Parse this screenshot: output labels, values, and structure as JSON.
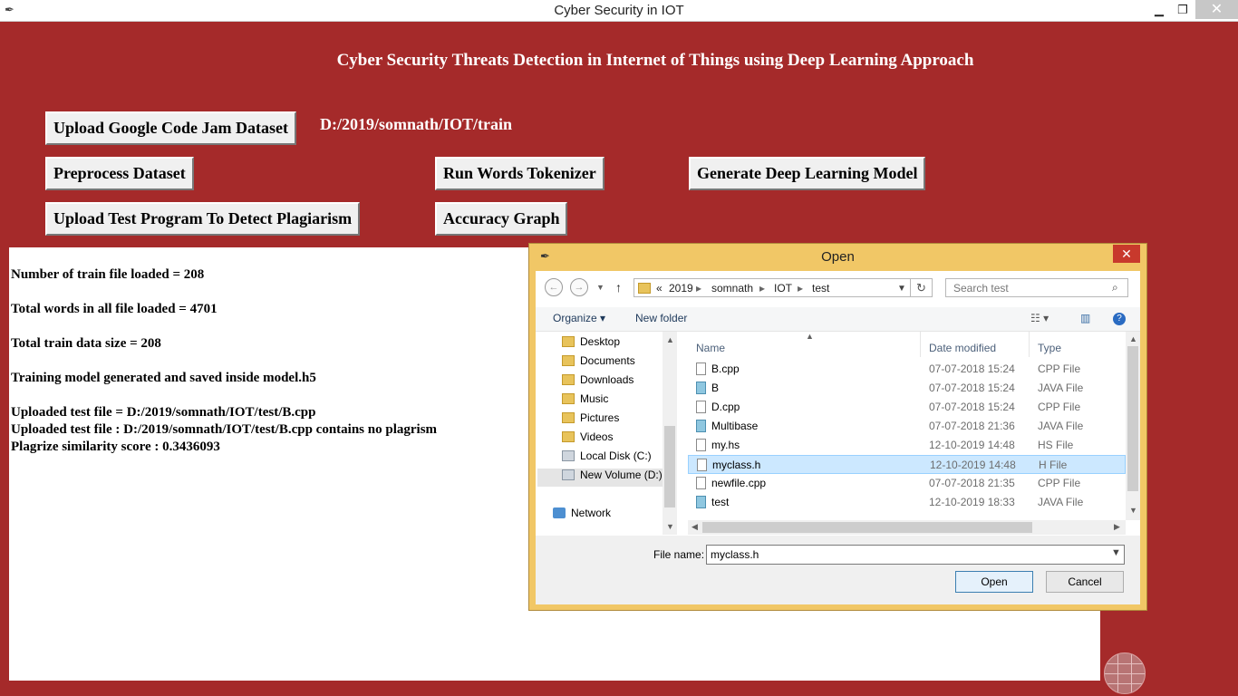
{
  "window": {
    "title": "Cyber Security in IOT"
  },
  "heading": "Cyber Security Threats Detection in Internet of Things using Deep Learning Approach",
  "buttons": {
    "upload_dataset": "Upload Google Code Jam Dataset",
    "preprocess": "Preprocess Dataset",
    "tokenizer": "Run Words Tokenizer",
    "generate_model": "Generate Deep Learning Model",
    "upload_test": "Upload Test Program To Detect Plagiarism",
    "accuracy_graph": "Accuracy Graph"
  },
  "dataset_path": "D:/2019/somnath/IOT/train",
  "output_lines": [
    "Number of train file loaded = 208",
    "Total words in all file loaded = 4701",
    "Total train data size = 208",
    "Training model generated and saved inside model.h5",
    "Uploaded test file = D:/2019/somnath/IOT/test/B.cpp",
    "Uploaded test file : D:/2019/somnath/IOT/test/B.cpp contains no plagrism",
    "Plagrize similarity score : 0.3436093"
  ],
  "dialog": {
    "title": "Open",
    "close_glyph": "✕",
    "address": {
      "prefix": "«",
      "crumbs": [
        "2019",
        "somnath",
        "IOT",
        "test"
      ]
    },
    "search_placeholder": "Search test",
    "toolbar": {
      "organize": "Organize ▾",
      "new_folder": "New folder"
    },
    "nav_items": [
      "Desktop",
      "Documents",
      "Downloads",
      "Music",
      "Pictures",
      "Videos",
      "Local Disk (C:)",
      "New Volume (D:)",
      "Network"
    ],
    "columns": {
      "name": "Name",
      "date": "Date modified",
      "type": "Type"
    },
    "files": [
      {
        "name": "B.cpp",
        "date": "07-07-2018 15:24",
        "type": "CPP File",
        "icon": "file-icon"
      },
      {
        "name": "B",
        "date": "07-07-2018 15:24",
        "type": "JAVA File",
        "icon": "java-file-icon"
      },
      {
        "name": "D.cpp",
        "date": "07-07-2018 15:24",
        "type": "CPP File",
        "icon": "file-icon"
      },
      {
        "name": "Multibase",
        "date": "07-07-2018 21:36",
        "type": "JAVA File",
        "icon": "java-file-icon"
      },
      {
        "name": "my.hs",
        "date": "12-10-2019 14:48",
        "type": "HS File",
        "icon": "file-icon"
      },
      {
        "name": "myclass.h",
        "date": "12-10-2019 14:48",
        "type": "H File",
        "icon": "file-icon",
        "selected": true
      },
      {
        "name": "newfile.cpp",
        "date": "07-07-2018 21:35",
        "type": "CPP File",
        "icon": "file-icon"
      },
      {
        "name": "test",
        "date": "12-10-2019 18:33",
        "type": "JAVA File",
        "icon": "java-file-icon"
      }
    ],
    "file_name_label": "File name:",
    "file_name_value": "myclass.h",
    "open_label": "Open",
    "cancel_label": "Cancel"
  },
  "colors": {
    "background": "#a52a2a",
    "dialog_frame": "#f1c766",
    "selected_row": "#cce8ff"
  }
}
